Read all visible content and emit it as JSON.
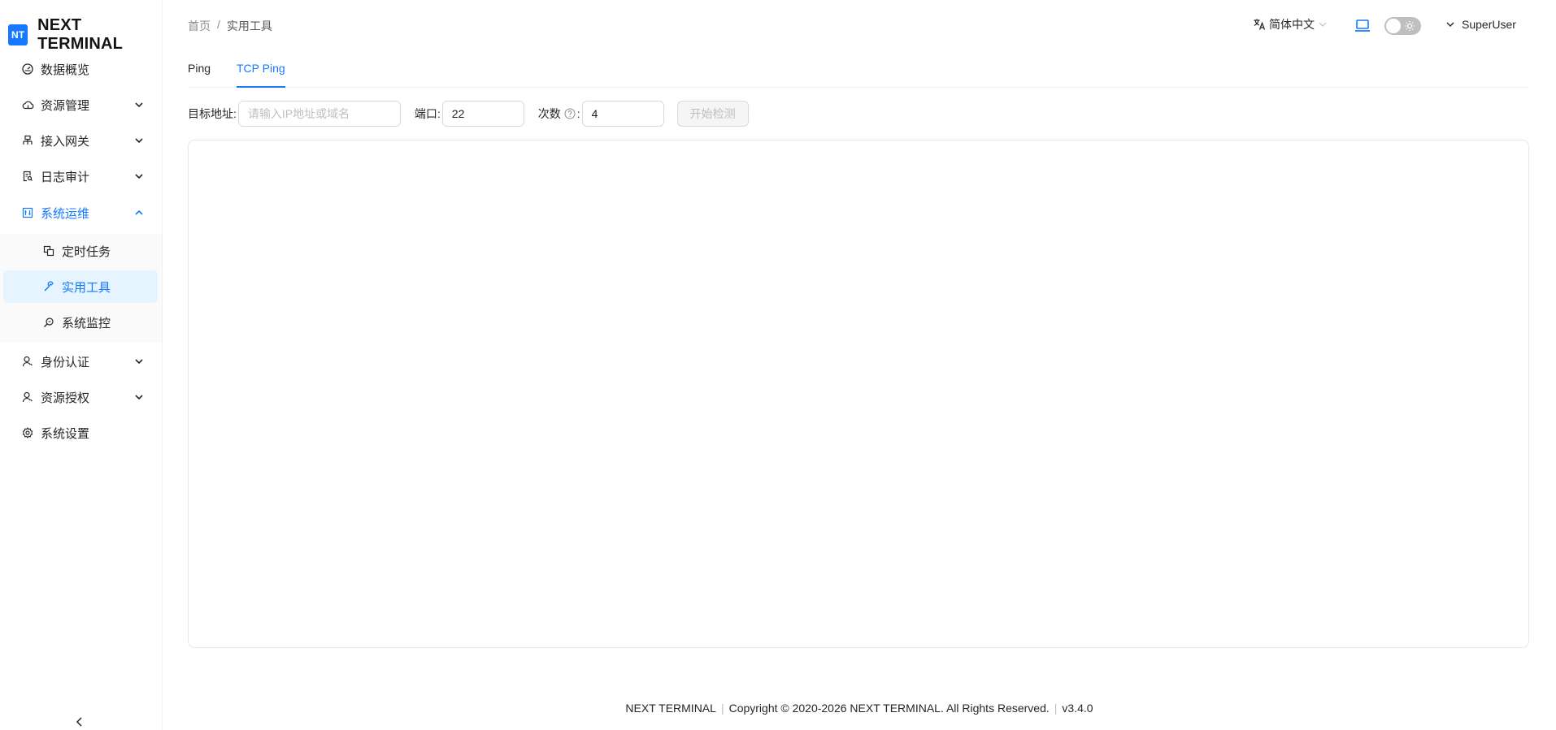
{
  "app": {
    "logo_mark": "NT",
    "title": "NEXT TERMINAL"
  },
  "sidebar": {
    "items": [
      {
        "label": "数据概览",
        "icon": "dashboard-icon"
      },
      {
        "label": "资源管理",
        "icon": "cloud-icon",
        "expandable": true
      },
      {
        "label": "接入网关",
        "icon": "gateway-icon",
        "expandable": true
      },
      {
        "label": "日志审计",
        "icon": "audit-icon",
        "expandable": true
      },
      {
        "label": "系统运维",
        "icon": "ops-icon",
        "expandable": true,
        "open": true
      },
      {
        "label": "身份认证",
        "icon": "user-icon",
        "expandable": true
      },
      {
        "label": "资源授权",
        "icon": "user-icon",
        "expandable": true
      },
      {
        "label": "系统设置",
        "icon": "gear-icon"
      }
    ],
    "subitems": [
      {
        "label": "定时任务",
        "icon": "schedule-icon"
      },
      {
        "label": "实用工具",
        "icon": "tool-icon",
        "active": true
      },
      {
        "label": "系统监控",
        "icon": "monitor-search-icon"
      }
    ]
  },
  "header": {
    "breadcrumb": [
      "首页",
      "/",
      "实用工具"
    ],
    "language": "简体中文",
    "user": "SuperUser"
  },
  "tabs": [
    {
      "label": "Ping",
      "active": false
    },
    {
      "label": "TCP Ping",
      "active": true
    }
  ],
  "form": {
    "target_label": "目标地址:",
    "target_placeholder": "请输入IP地址或域名",
    "target_value": "",
    "port_label": "端口:",
    "port_value": "22",
    "count_label": "次数",
    "count_suffix": ":",
    "count_value": "4",
    "start_button": "开始检测"
  },
  "footer": {
    "brand": "NEXT TERMINAL",
    "copyright": "Copyright © 2020-2026 NEXT TERMINAL. All Rights Reserved.",
    "version": "v3.4.0"
  },
  "colors": {
    "accent": "#1677ff",
    "active_bg": "#e6f4ff"
  }
}
